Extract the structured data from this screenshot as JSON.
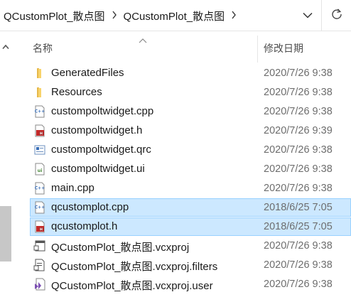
{
  "address_bar": {
    "breadcrumbs": [
      "QCustomPlot_散点图",
      "QCustomPlot_散点图"
    ],
    "separator_icon": "chevron-right-icon",
    "dropdown_icon": "chevron-down-icon",
    "refresh_icon": "refresh-icon"
  },
  "columns": {
    "name": "名称",
    "date": "修改日期"
  },
  "files": [
    {
      "name": "GeneratedFiles",
      "date": "2020/7/26 9:38",
      "icon": "folder-icon",
      "selected": false
    },
    {
      "name": "Resources",
      "date": "2020/7/26 9:38",
      "icon": "folder-icon",
      "selected": false
    },
    {
      "name": "custompoltwidget.cpp",
      "date": "2020/7/26 9:38",
      "icon": "cpp-file-icon",
      "selected": false
    },
    {
      "name": "custompoltwidget.h",
      "date": "2020/7/26 9:39",
      "icon": "header-file-icon",
      "selected": false
    },
    {
      "name": "custompoltwidget.qrc",
      "date": "2020/7/26 9:38",
      "icon": "qrc-file-icon",
      "selected": false
    },
    {
      "name": "custompoltwidget.ui",
      "date": "2020/7/26 9:38",
      "icon": "ui-file-icon",
      "selected": false
    },
    {
      "name": "main.cpp",
      "date": "2020/7/26 9:38",
      "icon": "cpp-file-icon",
      "selected": false
    },
    {
      "name": "qcustomplot.cpp",
      "date": "2018/6/25 7:05",
      "icon": "cpp-file-icon",
      "selected": true
    },
    {
      "name": "qcustomplot.h",
      "date": "2018/6/25 7:05",
      "icon": "header-file-icon",
      "selected": true
    },
    {
      "name": "QCustomPlot_散点图.vcxproj",
      "date": "2020/7/26 9:38",
      "icon": "vcxproj-file-icon",
      "selected": false
    },
    {
      "name": "QCustomPlot_散点图.vcxproj.filters",
      "date": "2020/7/26 9:38",
      "icon": "filters-file-icon",
      "selected": false
    },
    {
      "name": "QCustomPlot_散点图.vcxproj.user",
      "date": "2020/7/26 9:38",
      "icon": "vs-user-file-icon",
      "selected": false
    }
  ],
  "colors": {
    "selection": "#cce8ff",
    "selection_border": "#99d1ff",
    "folder": "#f8d36b",
    "cpp_text": "#3a6fb8",
    "header_red": "#c52a2a"
  }
}
